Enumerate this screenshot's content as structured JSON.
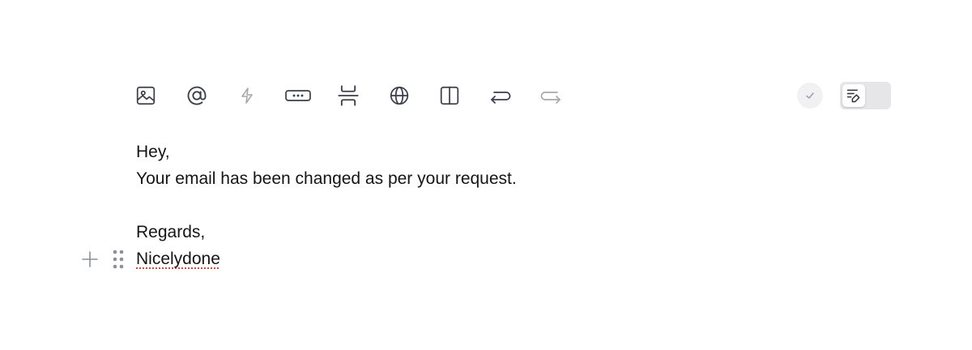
{
  "toolbar": {
    "tools": [
      {
        "icon": "image-icon",
        "enabled": true
      },
      {
        "icon": "at-mention-icon",
        "enabled": true
      },
      {
        "icon": "lightning-icon",
        "enabled": false
      },
      {
        "icon": "button-block-icon",
        "enabled": true
      },
      {
        "icon": "divider-icon",
        "enabled": true
      },
      {
        "icon": "globe-icon",
        "enabled": true
      },
      {
        "icon": "columns-icon",
        "enabled": true
      },
      {
        "icon": "undo-icon",
        "enabled": true
      },
      {
        "icon": "redo-icon",
        "enabled": false
      }
    ]
  },
  "controls": {
    "check_icon": "check-icon",
    "toggle_icon": "edit-mode-icon",
    "toggle_state": "edit"
  },
  "editor": {
    "lines": {
      "greeting": "Hey,",
      "body": "Your email has been changed as per your request.",
      "closing": "Regards,",
      "signature": "Nicelydone"
    }
  },
  "colors": {
    "text": "#151515",
    "icon": "#3a3f4a",
    "icon_disabled": "#9aa0aa",
    "spellcheck": "#e0433a",
    "toggle_bg": "#e6e6e9"
  }
}
